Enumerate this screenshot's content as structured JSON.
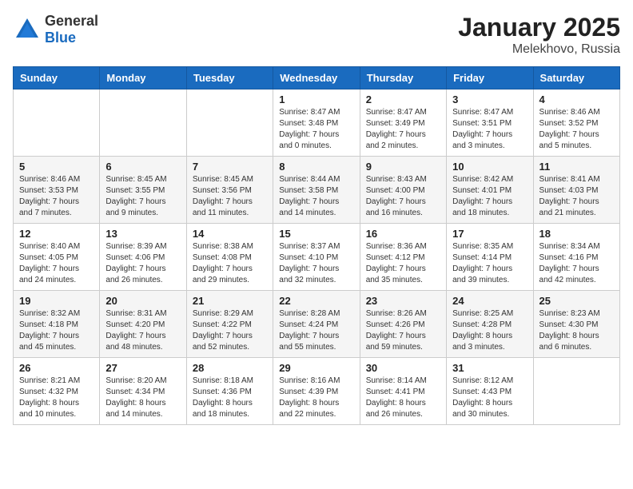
{
  "logo": {
    "general": "General",
    "blue": "Blue"
  },
  "title": "January 2025",
  "subtitle": "Melekhovo, Russia",
  "days_of_week": [
    "Sunday",
    "Monday",
    "Tuesday",
    "Wednesday",
    "Thursday",
    "Friday",
    "Saturday"
  ],
  "weeks": [
    [
      {
        "day": "",
        "info": ""
      },
      {
        "day": "",
        "info": ""
      },
      {
        "day": "",
        "info": ""
      },
      {
        "day": "1",
        "info": "Sunrise: 8:47 AM\nSunset: 3:48 PM\nDaylight: 7 hours and 0 minutes."
      },
      {
        "day": "2",
        "info": "Sunrise: 8:47 AM\nSunset: 3:49 PM\nDaylight: 7 hours and 2 minutes."
      },
      {
        "day": "3",
        "info": "Sunrise: 8:47 AM\nSunset: 3:51 PM\nDaylight: 7 hours and 3 minutes."
      },
      {
        "day": "4",
        "info": "Sunrise: 8:46 AM\nSunset: 3:52 PM\nDaylight: 7 hours and 5 minutes."
      }
    ],
    [
      {
        "day": "5",
        "info": "Sunrise: 8:46 AM\nSunset: 3:53 PM\nDaylight: 7 hours and 7 minutes."
      },
      {
        "day": "6",
        "info": "Sunrise: 8:45 AM\nSunset: 3:55 PM\nDaylight: 7 hours and 9 minutes."
      },
      {
        "day": "7",
        "info": "Sunrise: 8:45 AM\nSunset: 3:56 PM\nDaylight: 7 hours and 11 minutes."
      },
      {
        "day": "8",
        "info": "Sunrise: 8:44 AM\nSunset: 3:58 PM\nDaylight: 7 hours and 14 minutes."
      },
      {
        "day": "9",
        "info": "Sunrise: 8:43 AM\nSunset: 4:00 PM\nDaylight: 7 hours and 16 minutes."
      },
      {
        "day": "10",
        "info": "Sunrise: 8:42 AM\nSunset: 4:01 PM\nDaylight: 7 hours and 18 minutes."
      },
      {
        "day": "11",
        "info": "Sunrise: 8:41 AM\nSunset: 4:03 PM\nDaylight: 7 hours and 21 minutes."
      }
    ],
    [
      {
        "day": "12",
        "info": "Sunrise: 8:40 AM\nSunset: 4:05 PM\nDaylight: 7 hours and 24 minutes."
      },
      {
        "day": "13",
        "info": "Sunrise: 8:39 AM\nSunset: 4:06 PM\nDaylight: 7 hours and 26 minutes."
      },
      {
        "day": "14",
        "info": "Sunrise: 8:38 AM\nSunset: 4:08 PM\nDaylight: 7 hours and 29 minutes."
      },
      {
        "day": "15",
        "info": "Sunrise: 8:37 AM\nSunset: 4:10 PM\nDaylight: 7 hours and 32 minutes."
      },
      {
        "day": "16",
        "info": "Sunrise: 8:36 AM\nSunset: 4:12 PM\nDaylight: 7 hours and 35 minutes."
      },
      {
        "day": "17",
        "info": "Sunrise: 8:35 AM\nSunset: 4:14 PM\nDaylight: 7 hours and 39 minutes."
      },
      {
        "day": "18",
        "info": "Sunrise: 8:34 AM\nSunset: 4:16 PM\nDaylight: 7 hours and 42 minutes."
      }
    ],
    [
      {
        "day": "19",
        "info": "Sunrise: 8:32 AM\nSunset: 4:18 PM\nDaylight: 7 hours and 45 minutes."
      },
      {
        "day": "20",
        "info": "Sunrise: 8:31 AM\nSunset: 4:20 PM\nDaylight: 7 hours and 48 minutes."
      },
      {
        "day": "21",
        "info": "Sunrise: 8:29 AM\nSunset: 4:22 PM\nDaylight: 7 hours and 52 minutes."
      },
      {
        "day": "22",
        "info": "Sunrise: 8:28 AM\nSunset: 4:24 PM\nDaylight: 7 hours and 55 minutes."
      },
      {
        "day": "23",
        "info": "Sunrise: 8:26 AM\nSunset: 4:26 PM\nDaylight: 7 hours and 59 minutes."
      },
      {
        "day": "24",
        "info": "Sunrise: 8:25 AM\nSunset: 4:28 PM\nDaylight: 8 hours and 3 minutes."
      },
      {
        "day": "25",
        "info": "Sunrise: 8:23 AM\nSunset: 4:30 PM\nDaylight: 8 hours and 6 minutes."
      }
    ],
    [
      {
        "day": "26",
        "info": "Sunrise: 8:21 AM\nSunset: 4:32 PM\nDaylight: 8 hours and 10 minutes."
      },
      {
        "day": "27",
        "info": "Sunrise: 8:20 AM\nSunset: 4:34 PM\nDaylight: 8 hours and 14 minutes."
      },
      {
        "day": "28",
        "info": "Sunrise: 8:18 AM\nSunset: 4:36 PM\nDaylight: 8 hours and 18 minutes."
      },
      {
        "day": "29",
        "info": "Sunrise: 8:16 AM\nSunset: 4:39 PM\nDaylight: 8 hours and 22 minutes."
      },
      {
        "day": "30",
        "info": "Sunrise: 8:14 AM\nSunset: 4:41 PM\nDaylight: 8 hours and 26 minutes."
      },
      {
        "day": "31",
        "info": "Sunrise: 8:12 AM\nSunset: 4:43 PM\nDaylight: 8 hours and 30 minutes."
      },
      {
        "day": "",
        "info": ""
      }
    ]
  ]
}
